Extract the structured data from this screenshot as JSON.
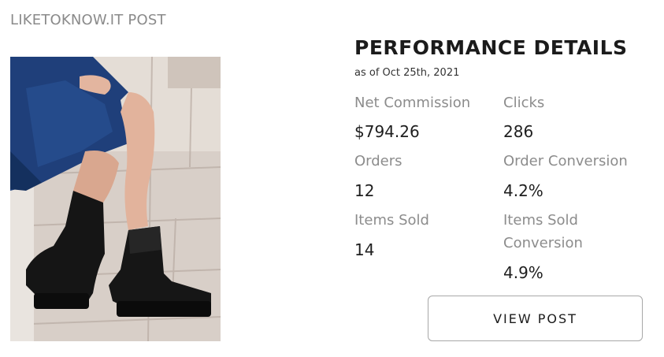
{
  "header": {
    "label": "LIKETOKNOW.IT POST"
  },
  "image": {
    "subject": "boots-photo"
  },
  "performance": {
    "title": "PERFORMANCE DETAILS",
    "as_of": "as of Oct 25th, 2021",
    "metrics": {
      "net_commission": {
        "label": "Net Commission",
        "value": "$794.26"
      },
      "clicks": {
        "label": "Clicks",
        "value": "286"
      },
      "orders": {
        "label": "Orders",
        "value": "12"
      },
      "order_conversion": {
        "label": "Order Conversion",
        "value": "4.2%"
      },
      "items_sold": {
        "label": "Items Sold",
        "value": "14"
      },
      "items_sold_conversion": {
        "label_line1": "Items Sold",
        "label_line2": "Conversion",
        "value": "4.9%"
      }
    }
  },
  "actions": {
    "view_post_label": "VIEW POST"
  },
  "colors": {
    "muted_text": "#8c8c8c",
    "button_border": "#a8a8a8",
    "dress_blue": "#1f3f7a"
  }
}
